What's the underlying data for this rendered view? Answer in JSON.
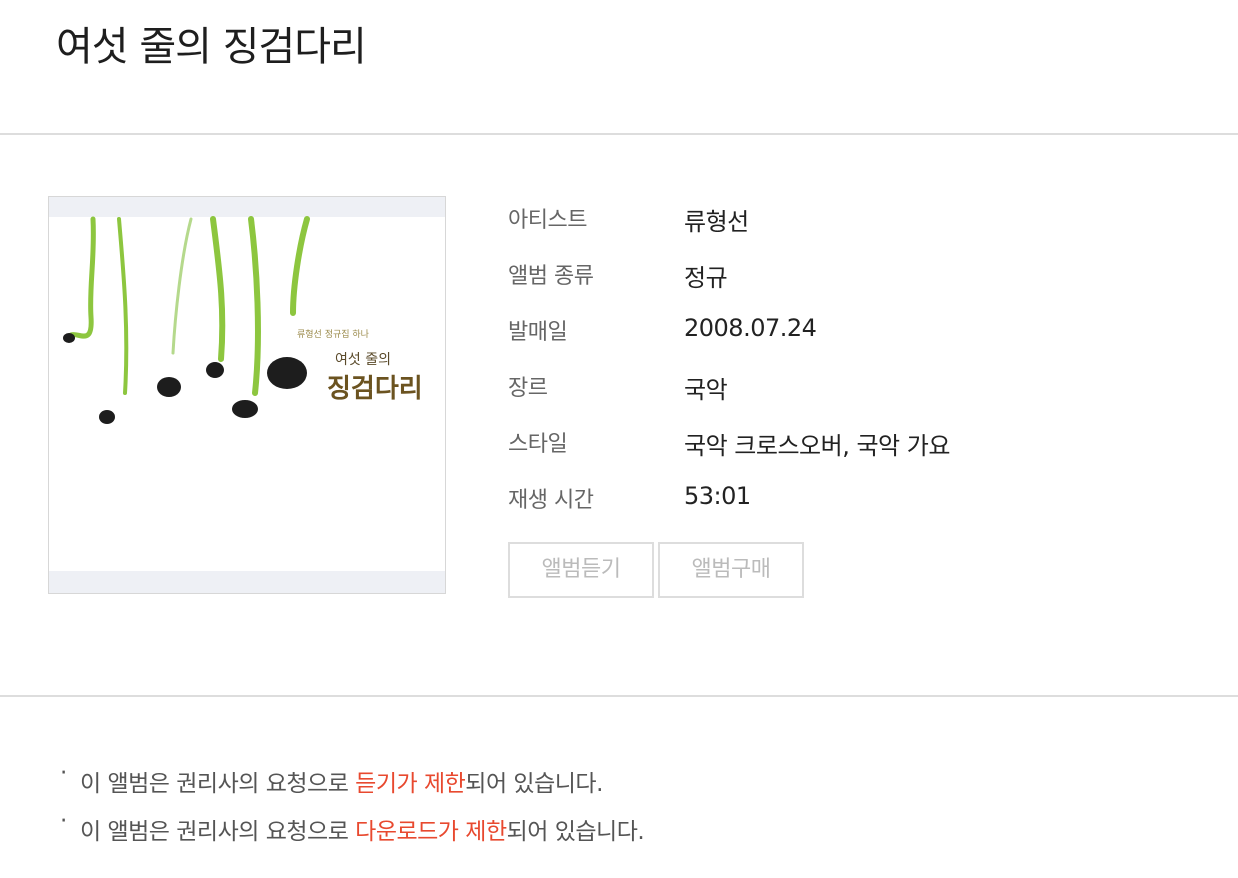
{
  "album": {
    "title": "여섯 줄의 징검다리",
    "cover": {
      "small_text": "류형선 정규집 하나",
      "title_line1": "여섯 줄의",
      "title_line2": "징검다리"
    }
  },
  "details": [
    {
      "label": "아티스트",
      "value": "류형선"
    },
    {
      "label": "앨범 종류",
      "value": "정규"
    },
    {
      "label": "발매일",
      "value": "2008.07.24"
    },
    {
      "label": "장르",
      "value": "국악"
    },
    {
      "label": "스타일",
      "value": "국악 크로스오버, 국악 가요"
    },
    {
      "label": "재생 시간",
      "value": "53:01"
    }
  ],
  "buttons": {
    "listen": "앨범듣기",
    "buy": "앨범구매"
  },
  "notices": [
    {
      "bullet": "·",
      "prefix": "이 앨범은 권리사의 요청으로 ",
      "highlight": "듣기가 제한",
      "suffix": "되어 있습니다."
    },
    {
      "bullet": "·",
      "prefix": "이 앨범은 권리사의 요청으로 ",
      "highlight": "다운로드가 제한",
      "suffix": "되어 있습니다."
    }
  ],
  "colors": {
    "highlight": "#e8492f",
    "divider": "#dddddd",
    "button_border": "#dddddd",
    "button_text": "#bbbbbb"
  }
}
